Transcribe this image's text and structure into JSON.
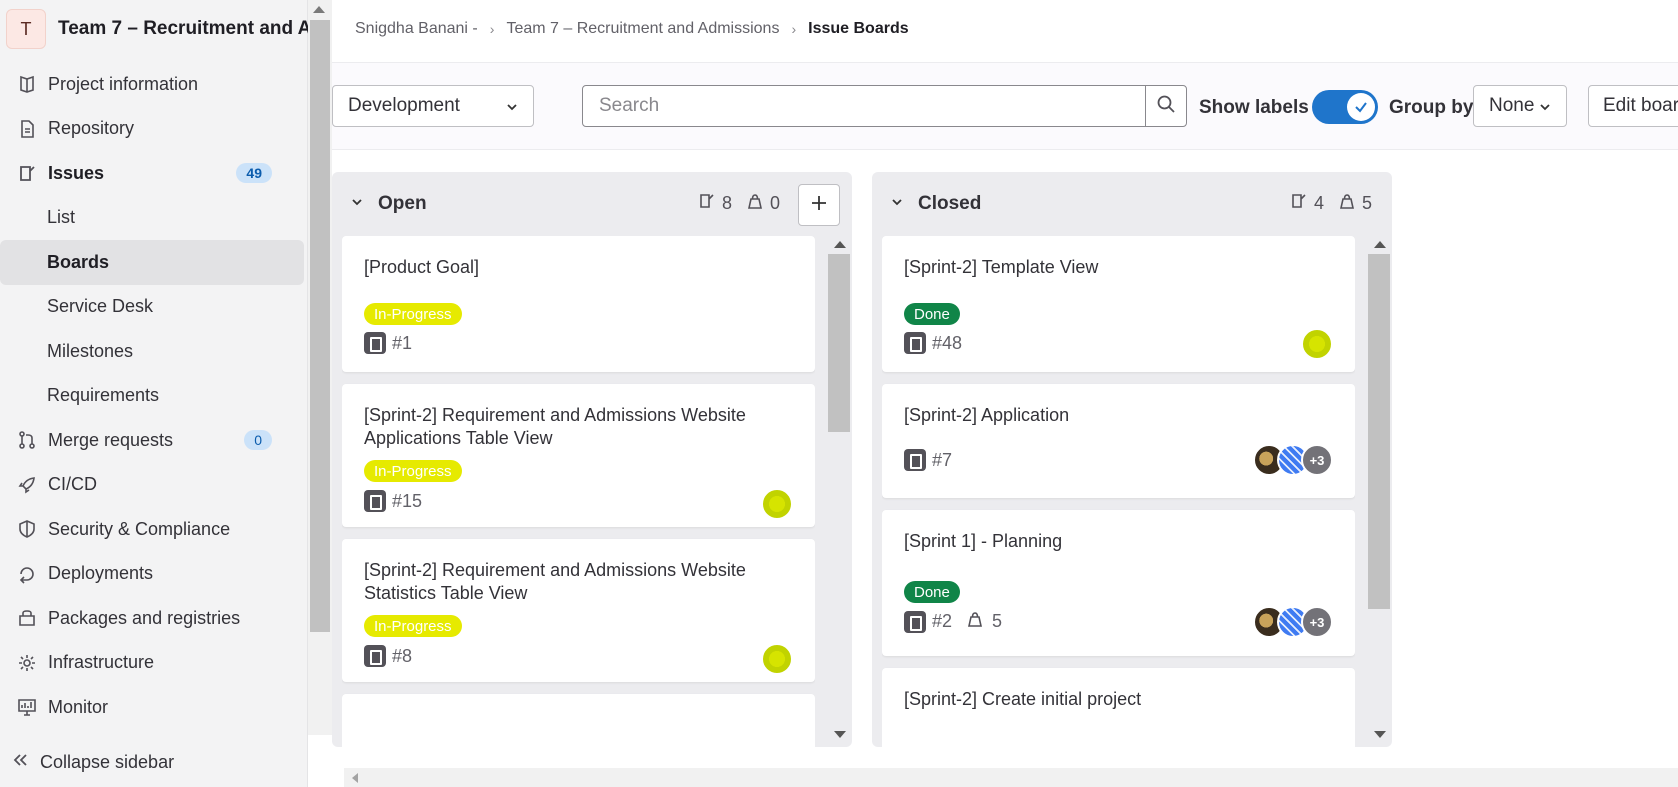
{
  "project": {
    "avatar_letter": "T",
    "title": "Team 7 – Recruitment and A..."
  },
  "sidebar": {
    "items": [
      {
        "label": "Project information",
        "icon": "project-info-icon"
      },
      {
        "label": "Repository",
        "icon": "document-icon"
      },
      {
        "label": "Issues",
        "icon": "issues-icon",
        "badge": "49"
      },
      {
        "label": "List"
      },
      {
        "label": "Boards",
        "active": true
      },
      {
        "label": "Service Desk"
      },
      {
        "label": "Milestones"
      },
      {
        "label": "Requirements"
      },
      {
        "label": "Merge requests",
        "icon": "merge-request-icon",
        "badge": "0"
      },
      {
        "label": "CI/CD",
        "icon": "rocket-icon"
      },
      {
        "label": "Security & Compliance",
        "icon": "shield-icon"
      },
      {
        "label": "Deployments",
        "icon": "deployments-icon"
      },
      {
        "label": "Packages and registries",
        "icon": "package-icon"
      },
      {
        "label": "Infrastructure",
        "icon": "cloud-gear-icon"
      },
      {
        "label": "Monitor",
        "icon": "monitor-icon"
      }
    ],
    "collapse_label": "Collapse sidebar"
  },
  "breadcrumb": [
    "Snigdha Banani -",
    "Team 7 – Recruitment and Admissions",
    "Issue Boards"
  ],
  "toolbar": {
    "board_select": "Development",
    "search_placeholder": "Search",
    "show_labels": "Show labels",
    "show_labels_on": true,
    "group_by_label": "Group by",
    "group_by_value": "None",
    "edit_board": "Edit board"
  },
  "lists": {
    "open": {
      "title": "Open",
      "issue_count": "8",
      "weight": "0",
      "cards": [
        {
          "title": "[Product Goal]",
          "label": "In-Progress",
          "ref": "#1"
        },
        {
          "title": "[Sprint-2] Requirement and Admissions Website Applications Table View",
          "label": "In-Progress",
          "ref": "#15"
        },
        {
          "title": "[Sprint-2] Requirement and Admissions Website Statistics Table View",
          "label": "In-Progress",
          "ref": "#8"
        }
      ]
    },
    "closed": {
      "title": "Closed",
      "issue_count": "4",
      "weight": "5",
      "cards": [
        {
          "title": "[Sprint-2] Template View",
          "label": "Done",
          "ref": "#48"
        },
        {
          "title": "[Sprint-2] Application",
          "ref": "#7",
          "more_avatars": "+3"
        },
        {
          "title": "[Sprint 1] - Planning",
          "label": "Done",
          "ref": "#2",
          "weight": "5",
          "more_avatars": "+3"
        },
        {
          "title": "[Sprint-2] Create initial project"
        }
      ]
    }
  },
  "colors": {
    "in_progress": "#e6ea00",
    "done": "#108548",
    "toggle": "#1f75cb",
    "badge_bg": "#cbe2f9"
  }
}
